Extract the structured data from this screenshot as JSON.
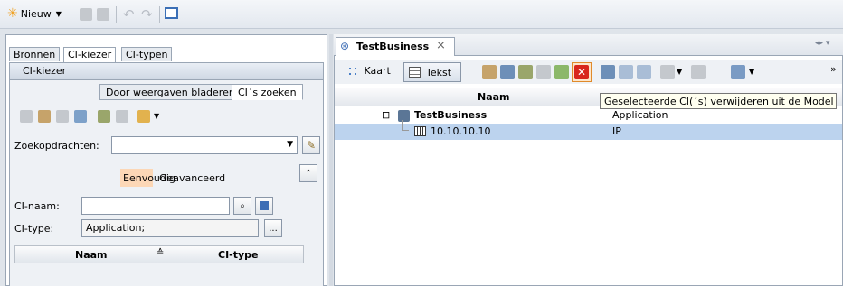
{
  "toolbar": {
    "new_label": "Nieuw",
    "new_icon": "star-icon"
  },
  "left": {
    "tabs": [
      "Bronnen",
      "CI-kiezer",
      "CI-typen"
    ],
    "header_title": "CI-kiezer",
    "subtabs": [
      "Door weergaven bladeren",
      "CI´s zoeken"
    ],
    "zoek_label": "Zoekopdrachten:",
    "zoek_value": "",
    "mode_tabs": [
      "Eenvoudig",
      "Geavanceerd"
    ],
    "ci_naam_label": "CI-naam:",
    "ci_naam_value": "",
    "ci_type_label": "CI-type:",
    "ci_type_value": "Application;",
    "ellipsis": "...",
    "table_headers": [
      "Naam",
      "CI-type"
    ]
  },
  "right": {
    "tab_title": "TestBusiness",
    "close": "×",
    "view_kaart": "Kaart",
    "view_tekst": "Tekst",
    "col_header": "Naam",
    "tooltip": "Geselecteerde CI(´s) verwijderen uit de Model",
    "rows": [
      {
        "name": "TestBusiness",
        "type": "Application",
        "expander": "⊟"
      },
      {
        "name": "10.10.10.10",
        "type": "IP"
      }
    ]
  },
  "colors": {
    "accent_orange": "#f0a020",
    "selected_row": "#bcd3ee",
    "delete_red": "#d8261c"
  }
}
